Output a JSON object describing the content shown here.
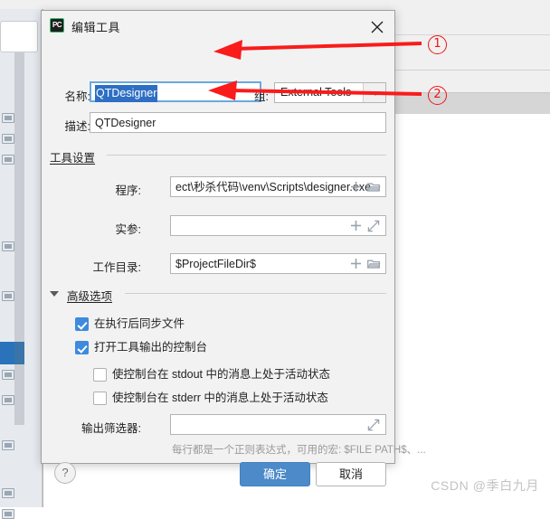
{
  "dialog": {
    "title": "编辑工具",
    "icon_label": "PC",
    "close_icon": "close-icon",
    "fields": {
      "name_label": "名称:",
      "name_value": "QTDesigner",
      "group_label": "组:",
      "group_value": "External Tools",
      "group_options": [
        "External Tools"
      ],
      "description_label": "描述:",
      "description_value": "QTDesigner"
    },
    "tool_settings": {
      "header": "工具设置",
      "program_label": "程序:",
      "program_value": "ect\\秒杀代码\\venv\\Scripts\\designer.exe",
      "arguments_label": "实参:",
      "arguments_value": "",
      "working_dir_label": "工作目录:",
      "working_dir_value": "$ProjectFileDir$"
    },
    "advanced": {
      "header": "高级选项",
      "expanded": true,
      "options": [
        {
          "label": "在执行后同步文件",
          "checked": true,
          "indent": 0
        },
        {
          "label": "打开工具输出的控制台",
          "checked": true,
          "indent": 0
        },
        {
          "label": "使控制台在 stdout 中的消息上处于活动状态",
          "checked": false,
          "indent": 1
        },
        {
          "label": "使控制台在 stderr 中的消息上处于活动状态",
          "checked": false,
          "indent": 1
        }
      ],
      "output_filter_label": "输出筛选器:",
      "output_filter_value": "",
      "output_filter_hint": "每行都是一个正则表达式，可用的宏: $FILE PATH$、..."
    },
    "footer": {
      "help_label": "?",
      "ok_label": "确定",
      "cancel_label": "取消"
    }
  },
  "annotations": [
    {
      "id": "1",
      "label": "①",
      "number": "1"
    },
    {
      "id": "2",
      "label": "②",
      "number": "2"
    }
  ],
  "watermark": "CSDN @季白九月",
  "colors": {
    "accent_blue": "#4c8ac9",
    "checkbox_blue": "#3d8ade",
    "selection_blue": "#2e6fc4",
    "annotation_red": "#f41414",
    "dialog_bg": "#f2f2f2",
    "sidebar_bg": "#e6eaef",
    "sidebar_selected": "#2a73bb",
    "watermark_gray": "#c3c3c3"
  }
}
